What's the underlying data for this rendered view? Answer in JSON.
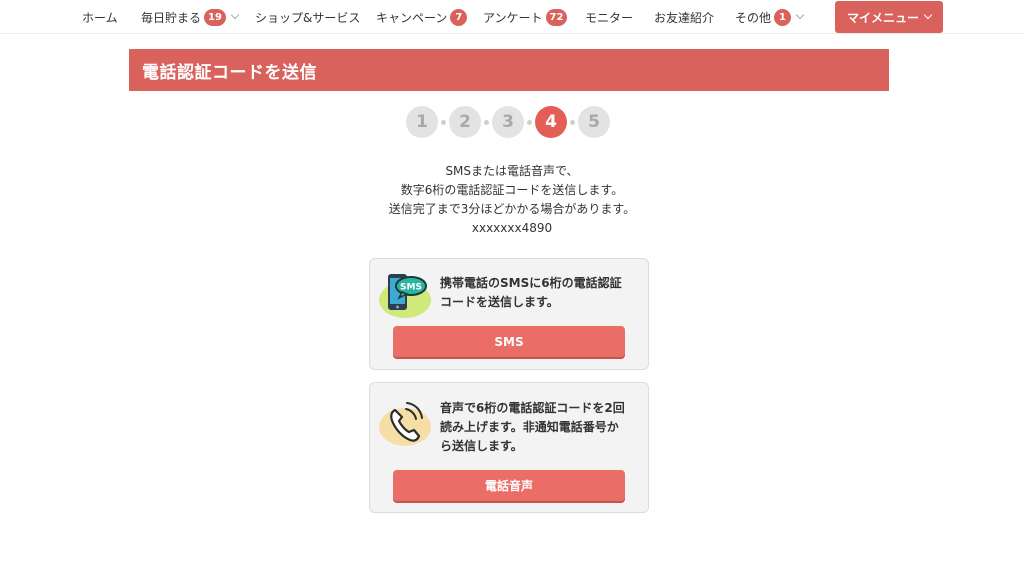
{
  "nav": {
    "items": [
      {
        "label": "ホーム"
      },
      {
        "label": "毎日貯まる",
        "badge": "19"
      },
      {
        "label": "ショップ&サービス"
      },
      {
        "label": "キャンペーン",
        "badge": "7"
      },
      {
        "label": "アンケート",
        "badge": "72"
      },
      {
        "label": "モニター"
      },
      {
        "label": "お友達紹介"
      },
      {
        "label": "その他",
        "badge": "1"
      }
    ],
    "mymenu": "マイメニュー"
  },
  "page": {
    "title": "電話認証コードを送信"
  },
  "steps": {
    "items": [
      "1",
      "2",
      "3",
      "4",
      "5"
    ],
    "current": "4"
  },
  "description": {
    "lines": [
      "SMSまたは電話音声で、",
      "数字6桁の電話認証コードを送信します。",
      "送信完了まで3分ほどかかる場合があります。",
      "xxxxxxx4890"
    ]
  },
  "sms_option": {
    "icon": "smartphone-sms-icon",
    "lines": [
      "携帯電話のSMSに6桁の電話認証",
      "コードを送信します。"
    ],
    "button": "SMS"
  },
  "voice_option": {
    "icon": "phone-ringing-icon",
    "lines": [
      "音声で6桁の電話認証コードを2回",
      "読み上げます。非通知電話番号か",
      "ら送信します。"
    ],
    "button": "電話音声"
  },
  "colors": {
    "accent": "#d9625c",
    "button": "#ea6e67",
    "step_active": "#e35e56",
    "step_inactive": "#e3e3e3"
  }
}
